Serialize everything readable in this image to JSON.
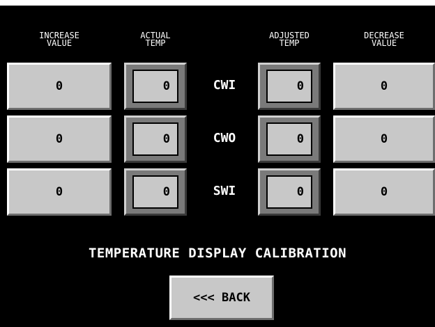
{
  "headers": {
    "increase": "INCREASE\nVALUE",
    "actual": "ACTUAL\nTEMP",
    "adjusted": "ADJUSTED\nTEMP",
    "decrease": "DECREASE\nVALUE"
  },
  "rows": [
    {
      "label": "CWI",
      "increase": "0",
      "actual": "0",
      "adjusted": "0",
      "decrease": "0"
    },
    {
      "label": "CWO",
      "increase": "0",
      "actual": "0",
      "adjusted": "0",
      "decrease": "0"
    },
    {
      "label": "SWI",
      "increase": "0",
      "actual": "0",
      "adjusted": "0",
      "decrease": "0"
    }
  ],
  "title": "TEMPERATURE DISPLAY CALIBRATION",
  "back_label": "<<< BACK",
  "colors": {
    "background": "#000000",
    "button": "#c8c8c8",
    "text": "#ffffff"
  }
}
